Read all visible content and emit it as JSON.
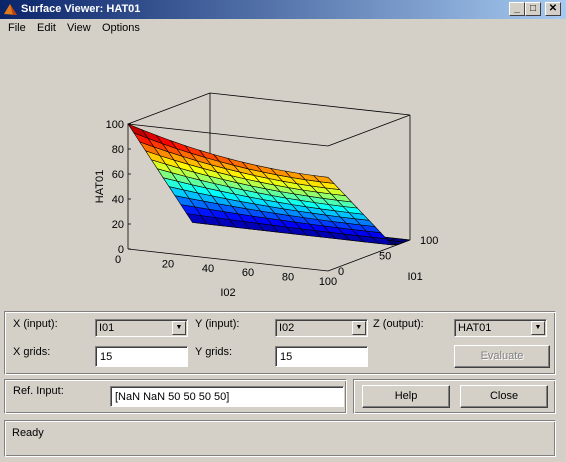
{
  "window": {
    "title": "Surface Viewer: HAT01"
  },
  "caption_buttons": {
    "minimize": "_",
    "maximize": "□",
    "close": "✕"
  },
  "menu": [
    "File",
    "Edit",
    "View",
    "Options"
  ],
  "chart_data": {
    "type": "surface",
    "title": "",
    "xlabel": "I02",
    "ylabel": "I01",
    "zlabel": "HAT01",
    "x_ticks": [
      "0",
      "20",
      "40",
      "60",
      "80",
      "100"
    ],
    "y_ticks": [
      "0",
      "50",
      "100"
    ],
    "z_ticks": [
      "0",
      "20",
      "40",
      "60",
      "80",
      "100"
    ],
    "xlim": [
      0,
      100
    ],
    "ylim": [
      0,
      100
    ],
    "zlim": [
      0,
      100
    ],
    "grid_points": 15,
    "colormap": "jet",
    "surface_values": {
      "note_x": "I02",
      "note_y": "I01",
      "corners": [
        {
          "I02": 0,
          "I01": 0,
          "HAT01": 100
        },
        {
          "I02": 100,
          "I01": 0,
          "HAT01": 75
        },
        {
          "I02": 0,
          "I01": 100,
          "HAT01": 0
        },
        {
          "I02": 100,
          "I01": 100,
          "HAT01": 0
        }
      ]
    }
  },
  "controls": {
    "x_input_label": "X (input):",
    "x_input_value": "I01",
    "y_input_label": "Y (input):",
    "y_input_value": "I02",
    "z_output_label": "Z (output):",
    "z_output_value": "HAT01",
    "x_grids_label": "X grids:",
    "x_grids_value": "15",
    "y_grids_label": "Y grids:",
    "y_grids_value": "15",
    "evaluate_label": "Evaluate"
  },
  "ref": {
    "label": "Ref. Input:",
    "value": "[NaN NaN 50 50 50 50]",
    "help_label": "Help",
    "close_label": "Close"
  },
  "status": {
    "text": "Ready"
  },
  "colors": {
    "title_start": "#0a246a",
    "title_end": "#a6caf0",
    "face": "#d4d0c8"
  }
}
